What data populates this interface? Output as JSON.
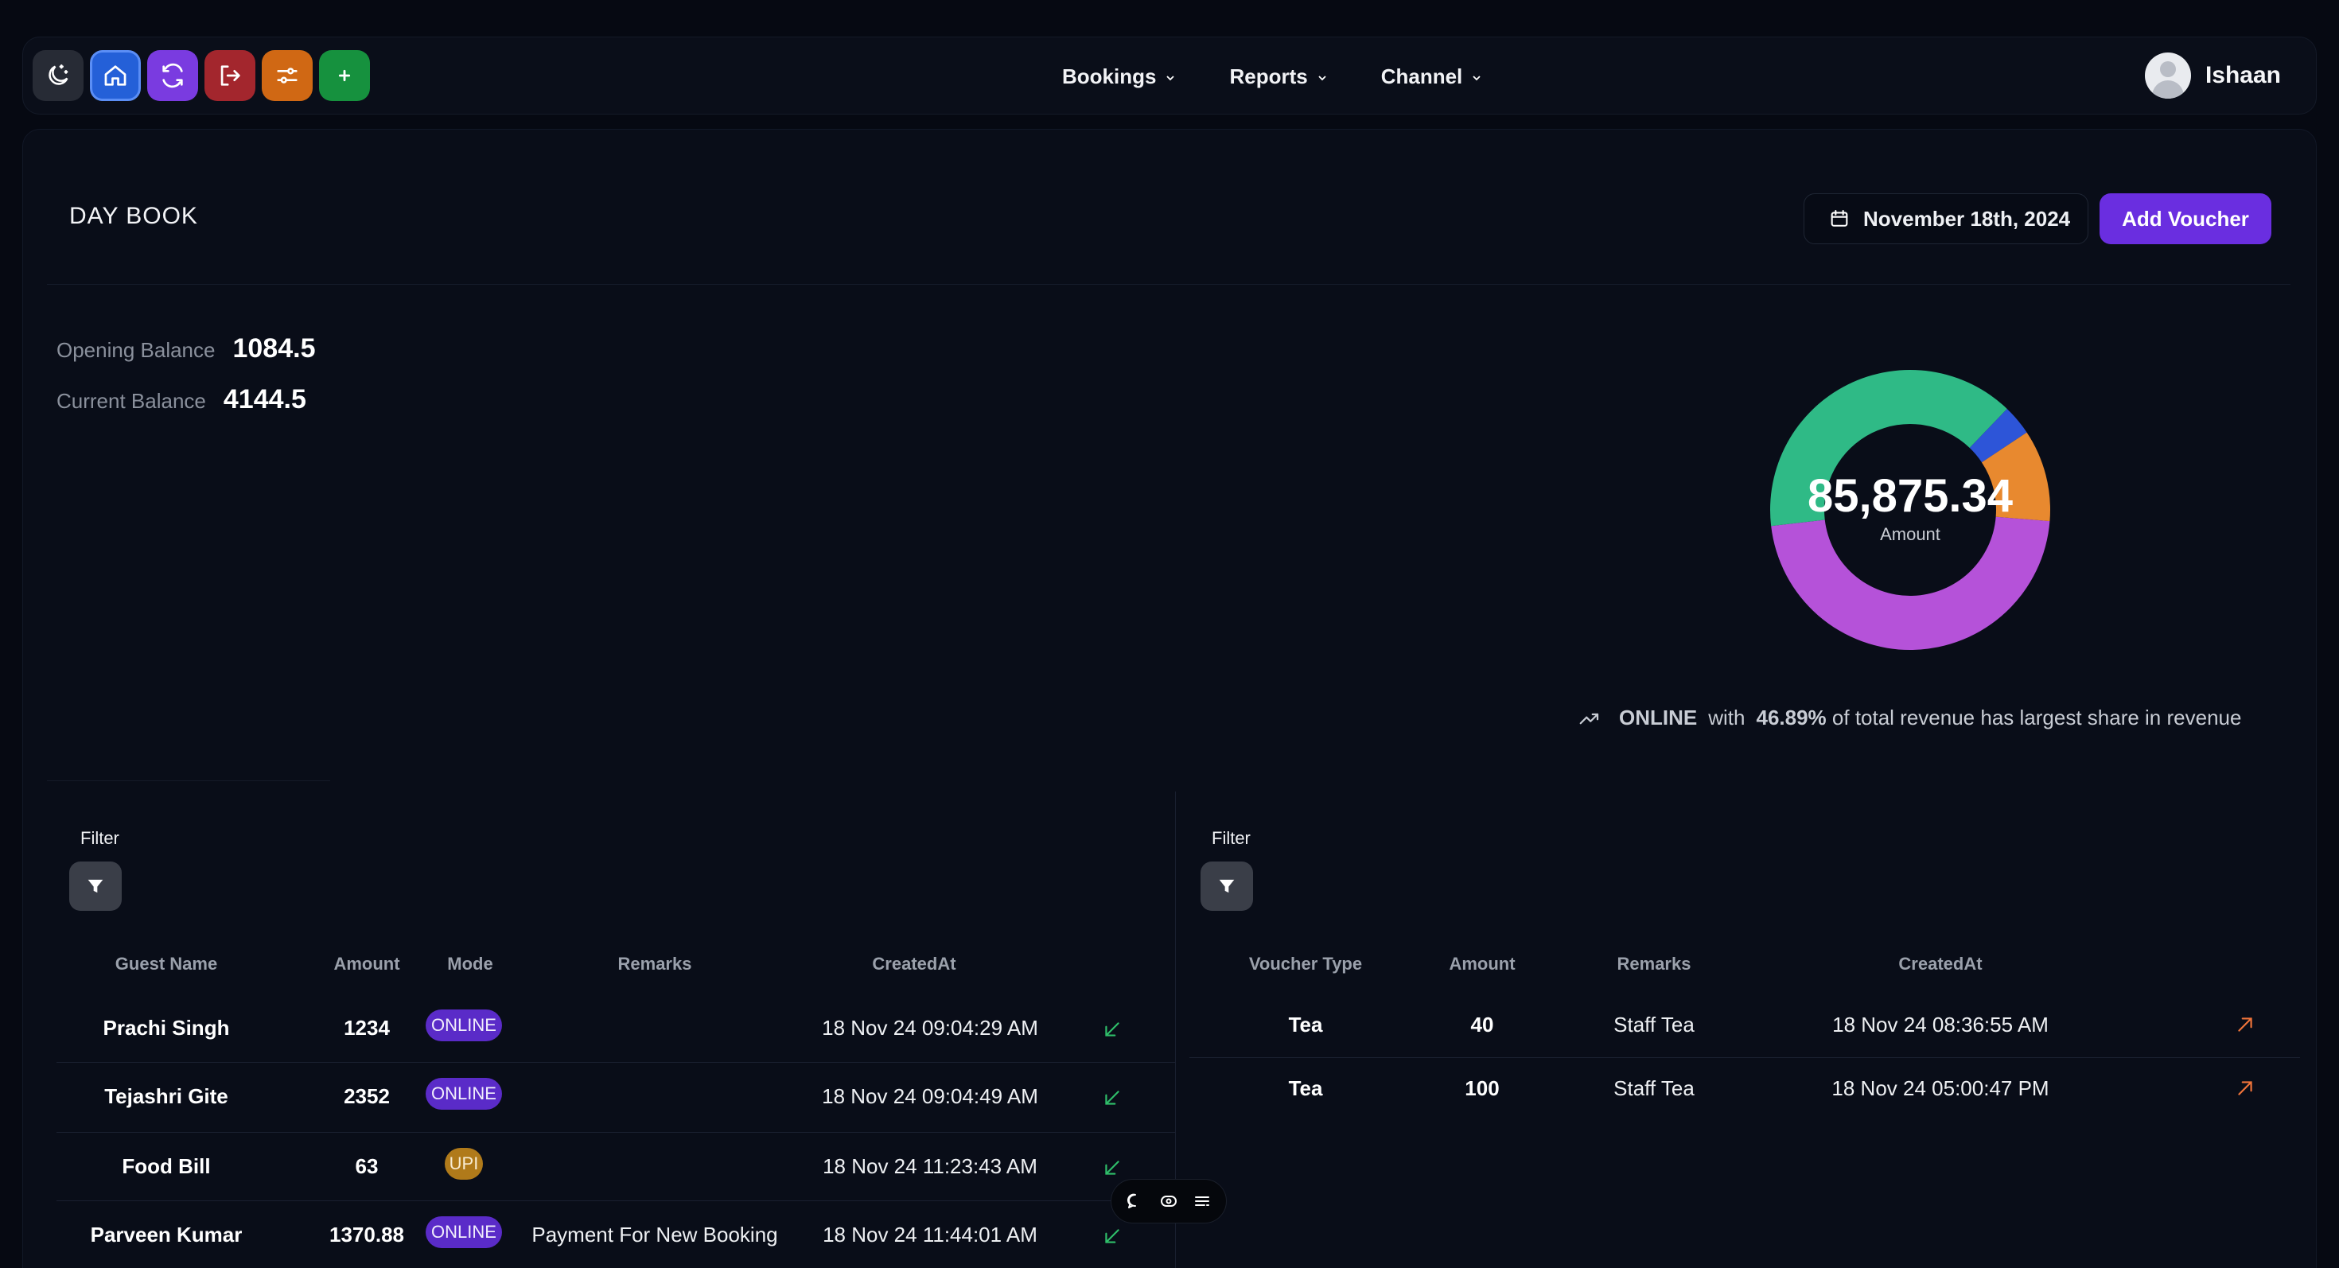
{
  "nav": {
    "icons": [
      "theme-toggle-icon",
      "home-icon",
      "sync-icon",
      "logout-icon",
      "settings-sliders-icon",
      "plus-icon"
    ],
    "menu": [
      {
        "label": "Bookings"
      },
      {
        "label": "Reports"
      },
      {
        "label": "Channel"
      }
    ],
    "user_name": "Ishaan"
  },
  "page": {
    "title": "DAY BOOK",
    "date": "November 18th, 2024",
    "add_voucher_label": "Add Voucher"
  },
  "balances": {
    "opening_label": "Opening Balance",
    "opening_value": "1084.5",
    "current_label": "Current Balance",
    "current_value": "4144.5"
  },
  "chart_data": {
    "type": "pie",
    "center_value": "85,875.34",
    "center_caption": "Amount",
    "slices": [
      {
        "share": 0.4689,
        "color": "#b552d9"
      },
      {
        "share": 0.39,
        "color": "#2fba86"
      },
      {
        "share": 0.035,
        "color": "#2d55d8"
      },
      {
        "share": 0.1061,
        "color": "#e8892f"
      }
    ],
    "insight": {
      "channel": "ONLINE",
      "prefix": "with",
      "percent": "46.89%",
      "suffix": "of total revenue has largest share in revenue"
    }
  },
  "left_table": {
    "filter_label": "Filter",
    "headers": [
      "Guest Name",
      "Amount",
      "Mode",
      "Remarks",
      "CreatedAt"
    ],
    "rows": [
      {
        "guest": "Prachi Singh",
        "amount": "1234",
        "mode": "ONLINE",
        "remarks": "",
        "created": "18 Nov 24 09:04:29 AM"
      },
      {
        "guest": "Tejashri Gite",
        "amount": "2352",
        "mode": "ONLINE",
        "remarks": "",
        "created": "18 Nov 24 09:04:49 AM"
      },
      {
        "guest": "Food Bill",
        "amount": "63",
        "mode": "UPI",
        "remarks": "",
        "created": "18 Nov 24 11:23:43 AM"
      },
      {
        "guest": "Parveen Kumar",
        "amount": "1370.88",
        "mode": "ONLINE",
        "remarks": "Payment For New Booking",
        "created": "18 Nov 24 11:44:01 AM"
      }
    ]
  },
  "right_table": {
    "filter_label": "Filter",
    "headers": [
      "Voucher Type",
      "Amount",
      "Remarks",
      "CreatedAt"
    ],
    "rows": [
      {
        "type": "Tea",
        "amount": "40",
        "remarks": "Staff Tea",
        "created": "18 Nov 24 08:36:55 AM"
      },
      {
        "type": "Tea",
        "amount": "100",
        "remarks": "Staff Tea",
        "created": "18 Nov 24 05:00:47 PM"
      }
    ]
  },
  "colors": {
    "accent": "#6a2ee0",
    "incoming_arrow": "#2fbf6a",
    "outgoing_arrow": "#f0743a"
  }
}
